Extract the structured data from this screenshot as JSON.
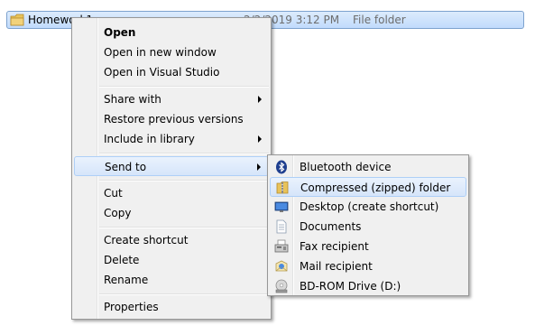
{
  "file_row": {
    "name": "Homework1",
    "date": "2/2/2019 3:12 PM",
    "type": "File folder",
    "icon": "folder-icon",
    "colors": {
      "selection_bg": "#cce0fb",
      "selection_border": "#7da2ce"
    }
  },
  "context_menu": {
    "items": [
      {
        "label": "Open",
        "bold": true
      },
      {
        "label": "Open in new window"
      },
      {
        "label": "Open in Visual Studio"
      },
      {
        "label": "Share with",
        "submenu": true
      },
      {
        "label": "Restore previous versions"
      },
      {
        "label": "Include in library",
        "submenu": true
      },
      {
        "label": "Send to",
        "submenu": true,
        "highlighted": true
      },
      {
        "label": "Cut"
      },
      {
        "label": "Copy"
      },
      {
        "label": "Create shortcut"
      },
      {
        "label": "Delete"
      },
      {
        "label": "Rename"
      },
      {
        "label": "Properties"
      }
    ]
  },
  "sendto_menu": {
    "items": [
      {
        "label": "Bluetooth device",
        "icon": "bluetooth-icon"
      },
      {
        "label": "Compressed (zipped) folder",
        "icon": "zip-folder-icon",
        "highlighted": true
      },
      {
        "label": "Desktop (create shortcut)",
        "icon": "desktop-icon"
      },
      {
        "label": "Documents",
        "icon": "documents-icon"
      },
      {
        "label": "Fax recipient",
        "icon": "fax-icon"
      },
      {
        "label": "Mail recipient",
        "icon": "mail-icon"
      },
      {
        "label": "BD-ROM Drive (D:)",
        "icon": "disc-drive-icon"
      }
    ]
  }
}
